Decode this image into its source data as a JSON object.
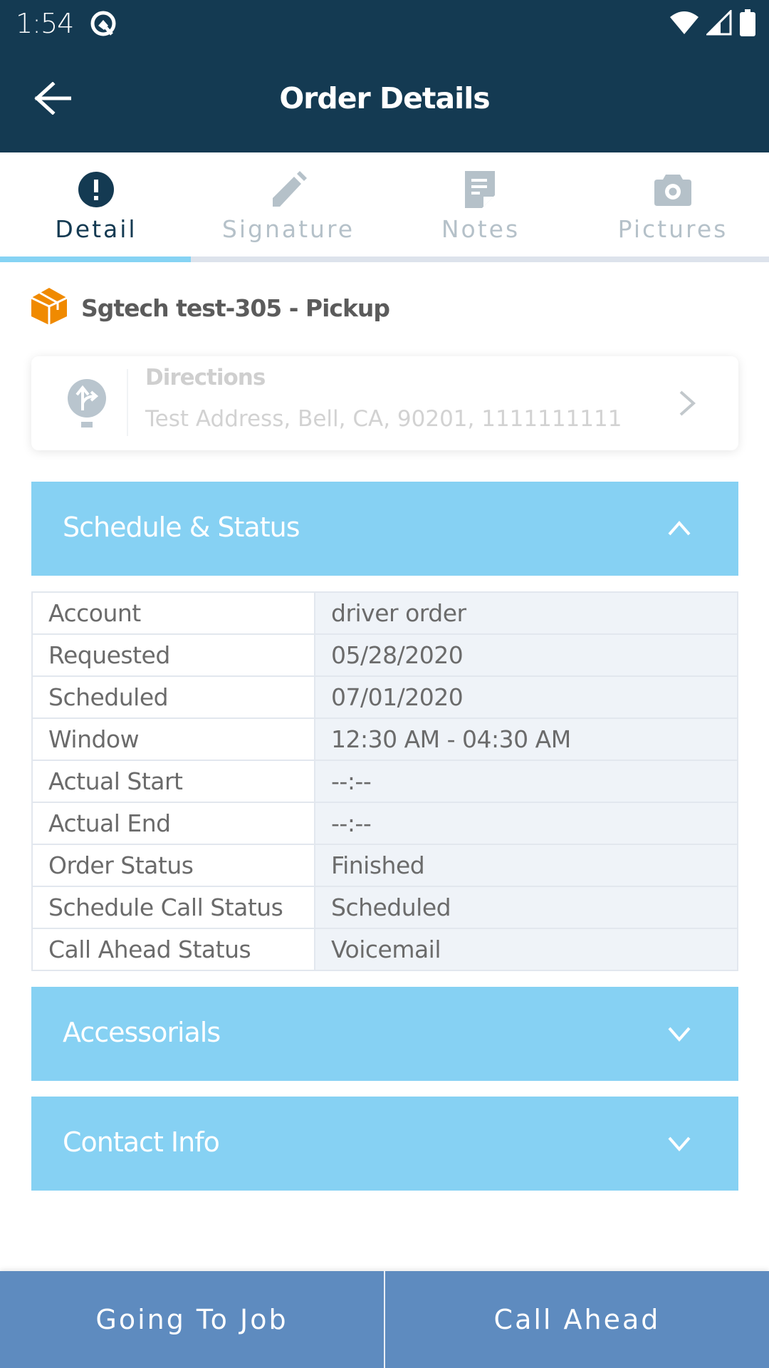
{
  "status_bar": {
    "time": "1:54",
    "icons": [
      "app-notification-icon",
      "wifi-icon",
      "cell-signal-icon",
      "battery-icon"
    ]
  },
  "app_bar": {
    "title": "Order Details",
    "back_icon": "arrow-left-icon"
  },
  "tabs": {
    "active_index": 0,
    "items": [
      {
        "label": "Detail",
        "icon": "exclamation-circle-icon"
      },
      {
        "label": "Signature",
        "icon": "pencil-icon"
      },
      {
        "label": "Notes",
        "icon": "note-icon"
      },
      {
        "label": "Pictures",
        "icon": "camera-icon"
      }
    ]
  },
  "order": {
    "title": "Sgtech test-305 - Pickup",
    "icon": "package-icon"
  },
  "directions": {
    "label": "Directions",
    "address": "Test Address, Bell, CA, 90201, 1111111111",
    "icon": "directions-icon"
  },
  "sections": {
    "schedule": {
      "title": "Schedule & Status",
      "expanded": true
    },
    "accessorials": {
      "title": "Accessorials",
      "expanded": false
    },
    "contact": {
      "title": "Contact Info",
      "expanded": false
    }
  },
  "schedule_rows": [
    {
      "label": "Account",
      "value": "driver order"
    },
    {
      "label": "Requested",
      "value": "05/28/2020"
    },
    {
      "label": "Scheduled",
      "value": "07/01/2020"
    },
    {
      "label": "Window",
      "value": "12:30 AM - 04:30 AM"
    },
    {
      "label": "Actual Start",
      "value": "--:--"
    },
    {
      "label": "Actual End",
      "value": "--:--"
    },
    {
      "label": "Order Status",
      "value": "Finished"
    },
    {
      "label": "Schedule Call Status",
      "value": "Scheduled"
    },
    {
      "label": "Call Ahead Status",
      "value": "Voicemail"
    }
  ],
  "bottom_bar": {
    "going_to_job": "Going To Job",
    "call_ahead": "Call Ahead"
  },
  "colors": {
    "primary_dark": "#143a52",
    "accent_light_blue": "#86d1f3",
    "bottom_button_blue": "#5e8bbf",
    "package_orange": "#f08a00"
  }
}
